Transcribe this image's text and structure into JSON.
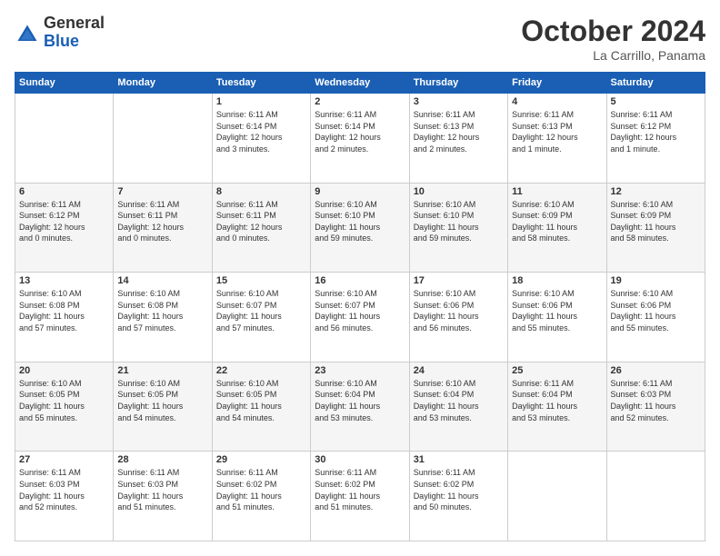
{
  "header": {
    "logo": {
      "line1": "General",
      "line2": "Blue"
    },
    "title": "October 2024",
    "location": "La Carrillo, Panama"
  },
  "weekdays": [
    "Sunday",
    "Monday",
    "Tuesday",
    "Wednesday",
    "Thursday",
    "Friday",
    "Saturday"
  ],
  "weeks": [
    [
      {
        "day": "",
        "info": ""
      },
      {
        "day": "",
        "info": ""
      },
      {
        "day": "1",
        "info": "Sunrise: 6:11 AM\nSunset: 6:14 PM\nDaylight: 12 hours\nand 3 minutes."
      },
      {
        "day": "2",
        "info": "Sunrise: 6:11 AM\nSunset: 6:14 PM\nDaylight: 12 hours\nand 2 minutes."
      },
      {
        "day": "3",
        "info": "Sunrise: 6:11 AM\nSunset: 6:13 PM\nDaylight: 12 hours\nand 2 minutes."
      },
      {
        "day": "4",
        "info": "Sunrise: 6:11 AM\nSunset: 6:13 PM\nDaylight: 12 hours\nand 1 minute."
      },
      {
        "day": "5",
        "info": "Sunrise: 6:11 AM\nSunset: 6:12 PM\nDaylight: 12 hours\nand 1 minute."
      }
    ],
    [
      {
        "day": "6",
        "info": "Sunrise: 6:11 AM\nSunset: 6:12 PM\nDaylight: 12 hours\nand 0 minutes."
      },
      {
        "day": "7",
        "info": "Sunrise: 6:11 AM\nSunset: 6:11 PM\nDaylight: 12 hours\nand 0 minutes."
      },
      {
        "day": "8",
        "info": "Sunrise: 6:11 AM\nSunset: 6:11 PM\nDaylight: 12 hours\nand 0 minutes."
      },
      {
        "day": "9",
        "info": "Sunrise: 6:10 AM\nSunset: 6:10 PM\nDaylight: 11 hours\nand 59 minutes."
      },
      {
        "day": "10",
        "info": "Sunrise: 6:10 AM\nSunset: 6:10 PM\nDaylight: 11 hours\nand 59 minutes."
      },
      {
        "day": "11",
        "info": "Sunrise: 6:10 AM\nSunset: 6:09 PM\nDaylight: 11 hours\nand 58 minutes."
      },
      {
        "day": "12",
        "info": "Sunrise: 6:10 AM\nSunset: 6:09 PM\nDaylight: 11 hours\nand 58 minutes."
      }
    ],
    [
      {
        "day": "13",
        "info": "Sunrise: 6:10 AM\nSunset: 6:08 PM\nDaylight: 11 hours\nand 57 minutes."
      },
      {
        "day": "14",
        "info": "Sunrise: 6:10 AM\nSunset: 6:08 PM\nDaylight: 11 hours\nand 57 minutes."
      },
      {
        "day": "15",
        "info": "Sunrise: 6:10 AM\nSunset: 6:07 PM\nDaylight: 11 hours\nand 57 minutes."
      },
      {
        "day": "16",
        "info": "Sunrise: 6:10 AM\nSunset: 6:07 PM\nDaylight: 11 hours\nand 56 minutes."
      },
      {
        "day": "17",
        "info": "Sunrise: 6:10 AM\nSunset: 6:06 PM\nDaylight: 11 hours\nand 56 minutes."
      },
      {
        "day": "18",
        "info": "Sunrise: 6:10 AM\nSunset: 6:06 PM\nDaylight: 11 hours\nand 55 minutes."
      },
      {
        "day": "19",
        "info": "Sunrise: 6:10 AM\nSunset: 6:06 PM\nDaylight: 11 hours\nand 55 minutes."
      }
    ],
    [
      {
        "day": "20",
        "info": "Sunrise: 6:10 AM\nSunset: 6:05 PM\nDaylight: 11 hours\nand 55 minutes."
      },
      {
        "day": "21",
        "info": "Sunrise: 6:10 AM\nSunset: 6:05 PM\nDaylight: 11 hours\nand 54 minutes."
      },
      {
        "day": "22",
        "info": "Sunrise: 6:10 AM\nSunset: 6:05 PM\nDaylight: 11 hours\nand 54 minutes."
      },
      {
        "day": "23",
        "info": "Sunrise: 6:10 AM\nSunset: 6:04 PM\nDaylight: 11 hours\nand 53 minutes."
      },
      {
        "day": "24",
        "info": "Sunrise: 6:10 AM\nSunset: 6:04 PM\nDaylight: 11 hours\nand 53 minutes."
      },
      {
        "day": "25",
        "info": "Sunrise: 6:11 AM\nSunset: 6:04 PM\nDaylight: 11 hours\nand 53 minutes."
      },
      {
        "day": "26",
        "info": "Sunrise: 6:11 AM\nSunset: 6:03 PM\nDaylight: 11 hours\nand 52 minutes."
      }
    ],
    [
      {
        "day": "27",
        "info": "Sunrise: 6:11 AM\nSunset: 6:03 PM\nDaylight: 11 hours\nand 52 minutes."
      },
      {
        "day": "28",
        "info": "Sunrise: 6:11 AM\nSunset: 6:03 PM\nDaylight: 11 hours\nand 51 minutes."
      },
      {
        "day": "29",
        "info": "Sunrise: 6:11 AM\nSunset: 6:02 PM\nDaylight: 11 hours\nand 51 minutes."
      },
      {
        "day": "30",
        "info": "Sunrise: 6:11 AM\nSunset: 6:02 PM\nDaylight: 11 hours\nand 51 minutes."
      },
      {
        "day": "31",
        "info": "Sunrise: 6:11 AM\nSunset: 6:02 PM\nDaylight: 11 hours\nand 50 minutes."
      },
      {
        "day": "",
        "info": ""
      },
      {
        "day": "",
        "info": ""
      }
    ]
  ]
}
